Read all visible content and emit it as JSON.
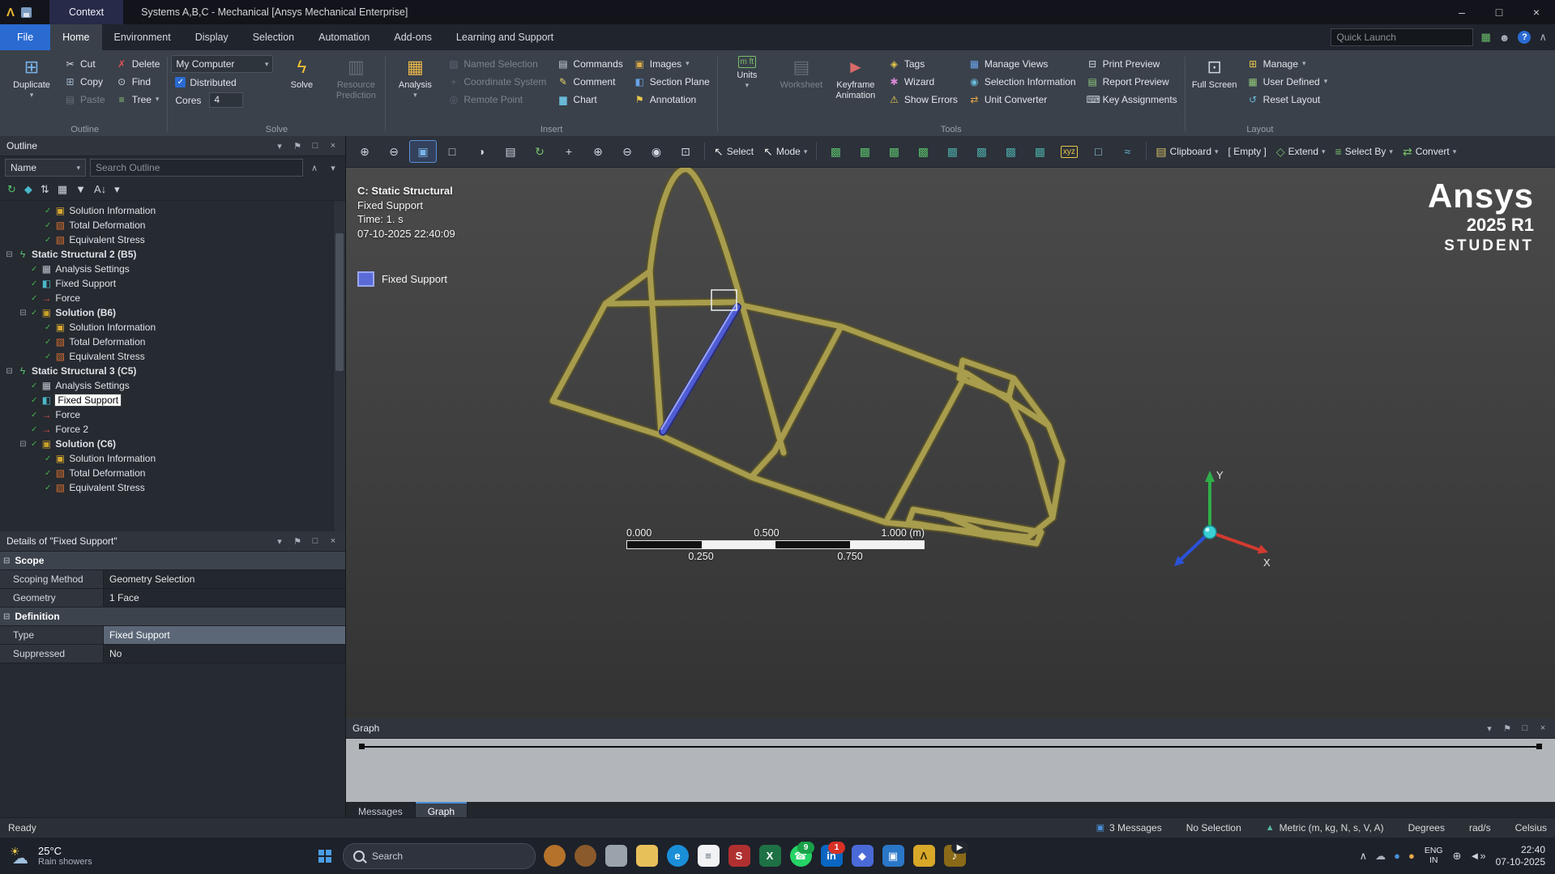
{
  "colors": {
    "accent_blue": "#2a6bd2",
    "ansys_gold": "#a89c4d",
    "fixed_support_blue": "#5a6bd8",
    "status_green": "#41b44d",
    "selected_row": "#5b6777"
  },
  "titlebar": {
    "context_tab": "Context",
    "title": "Systems A,B,C - Mechanical [Ansys Mechanical Enterprise]"
  },
  "menubar": {
    "tabs": [
      "File",
      "Home",
      "Environment",
      "Display",
      "Selection",
      "Automation",
      "Add-ons",
      "Learning and Support"
    ],
    "active_tab": "Home",
    "quick_launch_placeholder": "Quick Launch"
  },
  "ribbon": {
    "groups": [
      {
        "label": "Outline",
        "cells": [
          {
            "type": "big",
            "label": "Duplicate",
            "icon": "duplicate-icon",
            "arrow": true
          },
          {
            "type": "stack",
            "items": [
              {
                "label": "Cut",
                "icon": "cut-icon"
              },
              {
                "label": "Copy",
                "icon": "copy-icon"
              },
              {
                "label": "Paste",
                "icon": "paste-icon",
                "disabled": true
              }
            ]
          },
          {
            "type": "stack",
            "items": [
              {
                "label": "Delete",
                "icon": "delete-icon"
              },
              {
                "label": "Find",
                "icon": "find-icon"
              },
              {
                "label": "Tree",
                "icon": "tree-icon",
                "arrow": true
              }
            ]
          }
        ]
      },
      {
        "label": "Solve",
        "cells": [
          {
            "type": "stack",
            "items": [
              {
                "label": "My Computer",
                "control": "select"
              },
              {
                "label": "Distributed",
                "control": "checkbox",
                "checked": true
              },
              {
                "label": "Cores",
                "control": "input",
                "value": "4"
              }
            ]
          },
          {
            "type": "big",
            "label": "Solve",
            "icon": "solve-icon"
          },
          {
            "type": "big",
            "label": "Resource Prediction",
            "icon": "resource-prediction-icon",
            "disabled": true
          }
        ]
      },
      {
        "label": "Insert",
        "cells": [
          {
            "type": "big",
            "label": "Analysis",
            "icon": "analysis-icon",
            "arrow": true
          },
          {
            "type": "stack",
            "items": [
              {
                "label": "Named Selection",
                "icon": "named-selection-icon",
                "disabled": true
              },
              {
                "label": "Coordinate System",
                "icon": "coordinate-system-icon",
                "disabled": true
              },
              {
                "label": "Remote Point",
                "icon": "remote-point-icon",
                "disabled": true
              }
            ]
          },
          {
            "type": "stack",
            "items": [
              {
                "label": "Commands",
                "icon": "commands-icon"
              },
              {
                "label": "Comment",
                "icon": "comment-icon"
              },
              {
                "label": "Chart",
                "icon": "chart-icon"
              }
            ]
          },
          {
            "type": "stack",
            "items": [
              {
                "label": "Images",
                "icon": "images-icon",
                "arrow": true
              },
              {
                "label": "Section Plane",
                "icon": "section-plane-icon"
              },
              {
                "label": "Annotation",
                "icon": "annotation-icon"
              }
            ]
          }
        ]
      },
      {
        "label": "Tools",
        "cells": [
          {
            "type": "big",
            "label": "Units",
            "icon": "units-icon",
            "arrow": true
          },
          {
            "type": "big",
            "label": "Worksheet",
            "icon": "worksheet-icon",
            "disabled": true
          },
          {
            "type": "big",
            "label": "Keyframe Animation",
            "icon": "keyframe-animation-icon"
          },
          {
            "type": "stack",
            "items": [
              {
                "label": "Tags",
                "icon": "tags-icon"
              },
              {
                "label": "Wizard",
                "icon": "wizard-icon"
              },
              {
                "label": "Show Errors",
                "icon": "show-errors-icon"
              }
            ]
          },
          {
            "type": "stack",
            "items": [
              {
                "label": "Manage Views",
                "icon": "manage-views-icon"
              },
              {
                "label": "Selection Information",
                "icon": "selection-information-icon"
              },
              {
                "label": "Unit Converter",
                "icon": "unit-converter-icon"
              }
            ]
          },
          {
            "type": "stack",
            "items": [
              {
                "label": "Print Preview",
                "icon": "print-preview-icon"
              },
              {
                "label": "Report Preview",
                "icon": "report-preview-icon"
              },
              {
                "label": "Key Assignments",
                "icon": "key-assignments-icon"
              }
            ]
          }
        ]
      },
      {
        "label": "Layout",
        "cells": [
          {
            "type": "big",
            "label": "Full Screen",
            "icon": "full-screen-icon"
          },
          {
            "type": "stack",
            "items": [
              {
                "label": "Manage",
                "icon": "manage-icon",
                "arrow": true
              },
              {
                "label": "User Defined",
                "icon": "user-defined-icon",
                "arrow": true
              },
              {
                "label": "Reset Layout",
                "icon": "reset-layout-icon"
              }
            ]
          }
        ]
      }
    ]
  },
  "gfx_toolbar": {
    "items": [
      {
        "icon": "magnifier-zoom-in-icon",
        "name": "zoom-box-button"
      },
      {
        "icon": "magnifier-zoom-out-icon",
        "name": "zoom-back-button"
      },
      {
        "icon": "iso-view-icon",
        "name": "isometric-view-button",
        "active": true
      },
      {
        "icon": "view-cube-icon",
        "name": "view-cube-button"
      },
      {
        "icon": "orbit-view-icon",
        "name": "orbit-view-button"
      },
      {
        "icon": "screenshot-icon",
        "name": "image-capture-button"
      },
      {
        "icon": "refresh-view-icon",
        "name": "refresh-view-button"
      },
      {
        "icon": "pan-icon",
        "name": "pan-button"
      },
      {
        "icon": "zoom-in-icon",
        "name": "zoom-in-button"
      },
      {
        "icon": "zoom-out-icon",
        "name": "zoom-out-button"
      },
      {
        "icon": "zoom-fit-icon",
        "name": "zoom-fit-button"
      },
      {
        "icon": "zoom-box-icon",
        "name": "zoom-to-box-button"
      },
      {
        "sep": true
      },
      {
        "icon": "select-cursor-icon",
        "label": "Select",
        "name": "select-button"
      },
      {
        "icon": "mode-cursor-icon",
        "label": "Mode",
        "arrow": true,
        "name": "select-mode-button"
      },
      {
        "sep": true
      },
      {
        "icon": "vertex-select-icon",
        "name": "vertex-select-button"
      },
      {
        "icon": "edge-select-icon",
        "name": "edge-select-button"
      },
      {
        "icon": "face-select-icon",
        "name": "face-select-button"
      },
      {
        "icon": "body-select-icon",
        "name": "body-select-button"
      },
      {
        "icon": "multi-select-icon",
        "name": "multi-select-button"
      },
      {
        "icon": "box-select-icon",
        "name": "box-select-button"
      },
      {
        "icon": "lasso-select-icon",
        "name": "lasso-select-button"
      },
      {
        "icon": "select-through-icon",
        "name": "select-through-button"
      },
      {
        "icon": "xyz-icon",
        "name": "coordinates-button"
      },
      {
        "icon": "wireframe-icon",
        "name": "wireframe-button"
      },
      {
        "icon": "probe-chart-icon",
        "name": "probe-button"
      },
      {
        "sep": true
      },
      {
        "icon": "clipboard-icon",
        "label": "Clipboard",
        "arrow": true,
        "name": "clipboard-button"
      },
      {
        "label": "[ Empty ]",
        "name": "clipboard-empty-state"
      },
      {
        "icon": "extend-icon",
        "label": "Extend",
        "arrow": true,
        "name": "extend-button"
      },
      {
        "icon": "select-by-icon",
        "label": "Select By",
        "arrow": true,
        "name": "select-by-button"
      },
      {
        "icon": "convert-icon",
        "label": "Convert",
        "arrow": true,
        "name": "convert-button"
      }
    ]
  },
  "outline": {
    "title": "Outline",
    "name_filter": "Name",
    "search_placeholder": "Search Outline",
    "toolbar_icons": [
      "refresh-tree-icon",
      "eraser-icon",
      "sort-icon",
      "grid-icon",
      "filter-icon",
      "az-sort-icon",
      "expand-more-icon"
    ],
    "items": [
      {
        "label": "Solution Information",
        "level": 2,
        "icon": "solution-info-icon",
        "check": true
      },
      {
        "label": "Total Deformation",
        "level": 2,
        "icon": "result-icon",
        "check": true
      },
      {
        "label": "Equivalent Stress",
        "level": 2,
        "icon": "result-icon",
        "check": true
      },
      {
        "label": "Static Structural 2 (B5)",
        "level": 0,
        "icon": "static-structural-icon",
        "bold": true,
        "expander": true
      },
      {
        "label": "Analysis Settings",
        "level": 1,
        "icon": "analysis-settings-icon",
        "check": true
      },
      {
        "label": "Fixed Support",
        "level": 1,
        "icon": "support-icon",
        "check": true
      },
      {
        "label": "Force",
        "level": 1,
        "icon": "force-icon",
        "check": true
      },
      {
        "label": "Solution (B6)",
        "level": 1,
        "icon": "solution-icon",
        "bold": true,
        "expander": true,
        "check": true
      },
      {
        "label": "Solution Information",
        "level": 2,
        "icon": "solution-info-icon",
        "check": true
      },
      {
        "label": "Total Deformation",
        "level": 2,
        "icon": "result-icon",
        "check": true
      },
      {
        "label": "Equivalent Stress",
        "level": 2,
        "icon": "result-icon",
        "check": true
      },
      {
        "label": "Static Structural 3 (C5)",
        "level": 0,
        "icon": "static-structural-icon",
        "bold": true,
        "expander": true
      },
      {
        "label": "Analysis Settings",
        "level": 1,
        "icon": "analysis-settings-icon",
        "check": true
      },
      {
        "label": "Fixed Support",
        "level": 1,
        "icon": "support-icon",
        "check": true,
        "selected": true
      },
      {
        "label": "Force",
        "level": 1,
        "icon": "force-icon",
        "check": true
      },
      {
        "label": "Force 2",
        "level": 1,
        "icon": "force-icon",
        "check": true
      },
      {
        "label": "Solution (C6)",
        "level": 1,
        "icon": "solution-icon",
        "bold": true,
        "expander": true,
        "check": true
      },
      {
        "label": "Solution Information",
        "level": 2,
        "icon": "solution-info-icon",
        "check": true
      },
      {
        "label": "Total Deformation",
        "level": 2,
        "icon": "result-icon",
        "check": true
      },
      {
        "label": "Equivalent Stress",
        "level": 2,
        "icon": "result-icon",
        "check": true
      }
    ]
  },
  "details": {
    "title": "Details of \"Fixed Support\"",
    "rows": [
      {
        "section": true,
        "label": "Scope"
      },
      {
        "label": "Scoping Method",
        "value": "Geometry Selection"
      },
      {
        "label": "Geometry",
        "value": "1 Face"
      },
      {
        "section": true,
        "label": "Definition"
      },
      {
        "label": "Type",
        "value": "Fixed Support",
        "selected": true
      },
      {
        "label": "Suppressed",
        "value": "No"
      }
    ]
  },
  "viewport": {
    "annotation_lines": [
      "C: Static Structural",
      "Fixed Support",
      "Time: 1. s",
      "07-10-2025 22:40:09"
    ],
    "legend_label": "Fixed Support",
    "logo": {
      "brand": "Ansys",
      "release": "2025 R1",
      "edition": "STUDENT"
    },
    "ruler": {
      "top_labels": [
        "0.000",
        "0.500",
        "1.000 (m)"
      ],
      "bottom_labels": [
        "0.250",
        "0.750"
      ]
    },
    "triad": {
      "x_label": "X",
      "y_label": "Y"
    }
  },
  "graph": {
    "title": "Graph",
    "tabs": [
      "Messages",
      "Graph"
    ],
    "active_tab": "Graph"
  },
  "statusbar": {
    "left": "Ready",
    "items": [
      {
        "icon": "message-icon",
        "label": "3 Messages"
      },
      {
        "label": "No Selection"
      },
      {
        "icon": "triad-mini-icon",
        "label": "Metric (m, kg, N, s, V, A)"
      },
      {
        "label": "Degrees"
      },
      {
        "label": "rad/s"
      },
      {
        "label": "Celsius"
      }
    ]
  },
  "taskbar": {
    "weather": {
      "temp": "25°C",
      "condition": "Rain showers"
    },
    "search_placeholder": "Search",
    "apps": [
      {
        "name": "seasonal-squirrel-icon",
        "bg": "#b5722a",
        "round": true,
        "glyph": ""
      },
      {
        "name": "seasonal-acorn-icon",
        "bg": "#8a5a2a",
        "round": true,
        "glyph": ""
      },
      {
        "name": "pinned-app-gray-icon",
        "bg": "#9aa2ac",
        "glyph": ""
      },
      {
        "name": "file-explorer-icon",
        "bg": "#e8c05a",
        "glyph": ""
      },
      {
        "name": "edge-browser-icon",
        "bg": "#1a8fd8",
        "round": true,
        "glyph": "e"
      },
      {
        "name": "notepad-icon",
        "bg": "#f0f2f4",
        "fg": "#5a6570",
        "glyph": "≡"
      },
      {
        "name": "app-red-s-icon",
        "bg": "#b03030",
        "glyph": "S"
      },
      {
        "name": "excel-icon",
        "bg": "#1e7145",
        "glyph": "X"
      },
      {
        "name": "whatsapp-icon",
        "bg": "#25d366",
        "round": true,
        "glyph": "☎",
        "badge": "9",
        "badge_color": "#18a048"
      },
      {
        "name": "linkedin-icon",
        "bg": "#0a66c2",
        "glyph": "in",
        "badge": "1",
        "badge_color": "#d93025"
      },
      {
        "name": "photos-app-icon",
        "bg": "#4a6ad8",
        "glyph": "◆"
      },
      {
        "name": "remote-app-icon",
        "bg": "#2a77c8",
        "glyph": "▣"
      },
      {
        "name": "ansys-mechanical-icon",
        "bg": "#d8a828",
        "fg": "#3a2f08",
        "glyph": "Λ"
      },
      {
        "name": "media-app-icon",
        "bg": "#8a6a18",
        "glyph": "♪",
        "badge": "▶",
        "badge_color": "#23272e"
      }
    ],
    "tray_left_icons": [
      {
        "name": "hidden-icons-chevron-icon",
        "glyph": "∧"
      },
      {
        "name": "onedrive-icon",
        "glyph": "☁",
        "color": "#aab1ba"
      },
      {
        "name": "tray-app-blue-icon",
        "glyph": "●",
        "color": "#4a90d8"
      },
      {
        "name": "tray-app-orange-icon",
        "glyph": "●",
        "color": "#e8a84a"
      }
    ],
    "language": {
      "line1": "ENG",
      "line2": "IN"
    },
    "tray_right_icons": [
      {
        "name": "network-icon",
        "glyph": "⊕"
      },
      {
        "name": "volume-icon",
        "glyph": "◄»"
      }
    ],
    "clock": {
      "time": "22:40",
      "date": "07-10-2025"
    }
  }
}
